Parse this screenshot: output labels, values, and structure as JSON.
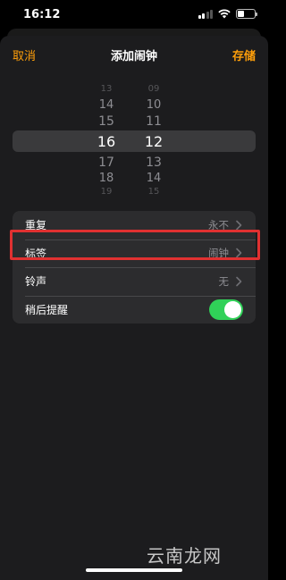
{
  "status_bar": {
    "time": "16:12"
  },
  "nav": {
    "cancel": "取消",
    "title": "添加闹钟",
    "save": "存储"
  },
  "picker": {
    "hours": [
      "13",
      "14",
      "15",
      "16",
      "17",
      "18",
      "19"
    ],
    "minutes": [
      "09",
      "10",
      "11",
      "12",
      "13",
      "14",
      "15"
    ],
    "selected_hour": "16",
    "selected_minute": "12"
  },
  "settings": {
    "repeat": {
      "label": "重复",
      "value": "永不"
    },
    "tag": {
      "label": "标签",
      "value": "闹钟"
    },
    "sound": {
      "label": "铃声",
      "value": "无"
    },
    "snooze": {
      "label": "稍后提醒",
      "on": true
    }
  },
  "watermark": "云南龙网",
  "colors": {
    "accent": "#ff9f0a",
    "toggle_on": "#30d158",
    "highlight": "#e03131"
  }
}
